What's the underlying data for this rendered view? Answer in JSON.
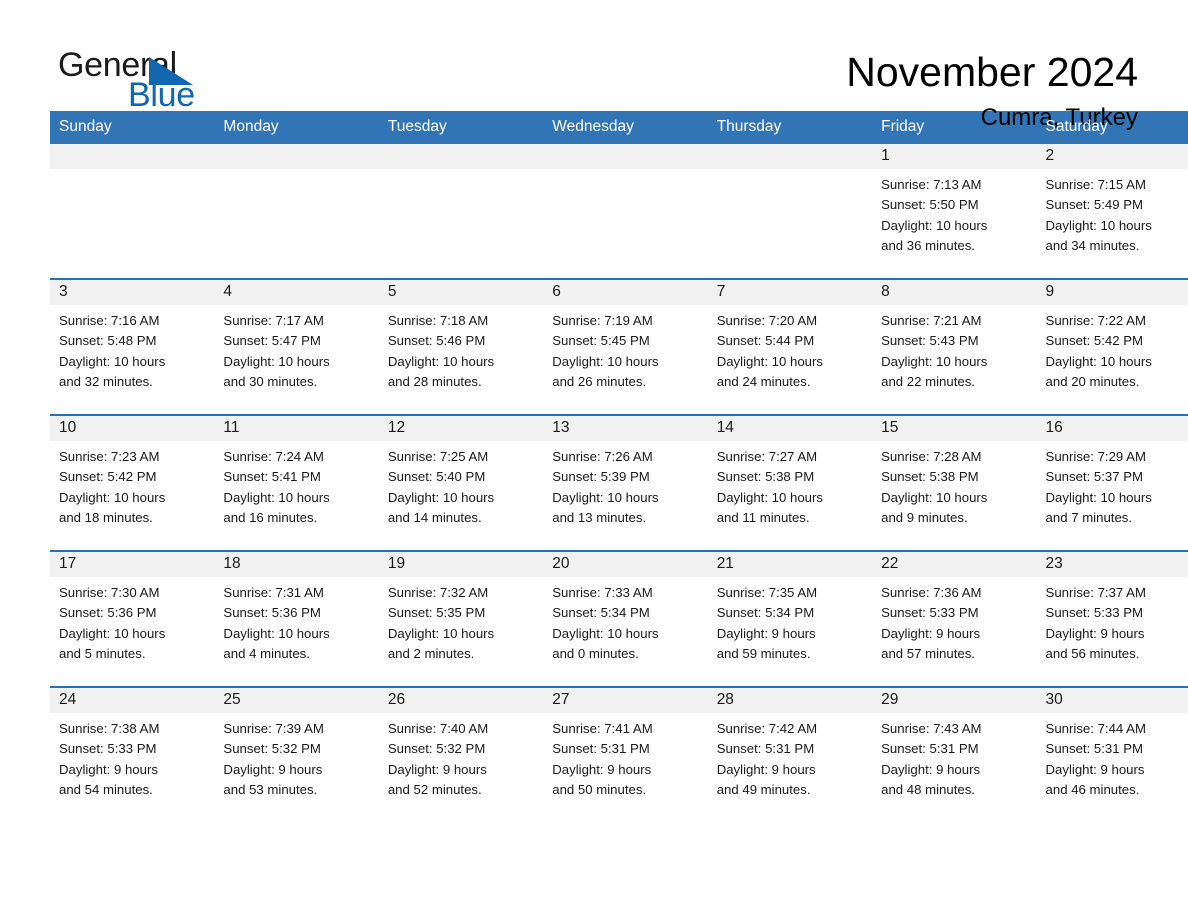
{
  "brand": {
    "name_part1": "General",
    "name_part2": "Blue",
    "flag_icon": "blue-triangle-flag-icon",
    "accent_color": "#1267b0"
  },
  "header": {
    "month_title": "November 2024",
    "location": "Cumra, Turkey"
  },
  "colors": {
    "header_blue": "#3275b7",
    "row_divider_blue": "#2c6fb1",
    "daynum_band": "#f1f1f1",
    "text": "#1a1a1a"
  },
  "calendar": {
    "weekday_headers": [
      "Sunday",
      "Monday",
      "Tuesday",
      "Wednesday",
      "Thursday",
      "Friday",
      "Saturday"
    ],
    "weeks": [
      [
        {
          "day": "",
          "lines": []
        },
        {
          "day": "",
          "lines": []
        },
        {
          "day": "",
          "lines": []
        },
        {
          "day": "",
          "lines": []
        },
        {
          "day": "",
          "lines": []
        },
        {
          "day": "1",
          "lines": [
            "Sunrise: 7:13 AM",
            "Sunset: 5:50 PM",
            "Daylight: 10 hours",
            "and 36 minutes."
          ]
        },
        {
          "day": "2",
          "lines": [
            "Sunrise: 7:15 AM",
            "Sunset: 5:49 PM",
            "Daylight: 10 hours",
            "and 34 minutes."
          ]
        }
      ],
      [
        {
          "day": "3",
          "lines": [
            "Sunrise: 7:16 AM",
            "Sunset: 5:48 PM",
            "Daylight: 10 hours",
            "and 32 minutes."
          ]
        },
        {
          "day": "4",
          "lines": [
            "Sunrise: 7:17 AM",
            "Sunset: 5:47 PM",
            "Daylight: 10 hours",
            "and 30 minutes."
          ]
        },
        {
          "day": "5",
          "lines": [
            "Sunrise: 7:18 AM",
            "Sunset: 5:46 PM",
            "Daylight: 10 hours",
            "and 28 minutes."
          ]
        },
        {
          "day": "6",
          "lines": [
            "Sunrise: 7:19 AM",
            "Sunset: 5:45 PM",
            "Daylight: 10 hours",
            "and 26 minutes."
          ]
        },
        {
          "day": "7",
          "lines": [
            "Sunrise: 7:20 AM",
            "Sunset: 5:44 PM",
            "Daylight: 10 hours",
            "and 24 minutes."
          ]
        },
        {
          "day": "8",
          "lines": [
            "Sunrise: 7:21 AM",
            "Sunset: 5:43 PM",
            "Daylight: 10 hours",
            "and 22 minutes."
          ]
        },
        {
          "day": "9",
          "lines": [
            "Sunrise: 7:22 AM",
            "Sunset: 5:42 PM",
            "Daylight: 10 hours",
            "and 20 minutes."
          ]
        }
      ],
      [
        {
          "day": "10",
          "lines": [
            "Sunrise: 7:23 AM",
            "Sunset: 5:42 PM",
            "Daylight: 10 hours",
            "and 18 minutes."
          ]
        },
        {
          "day": "11",
          "lines": [
            "Sunrise: 7:24 AM",
            "Sunset: 5:41 PM",
            "Daylight: 10 hours",
            "and 16 minutes."
          ]
        },
        {
          "day": "12",
          "lines": [
            "Sunrise: 7:25 AM",
            "Sunset: 5:40 PM",
            "Daylight: 10 hours",
            "and 14 minutes."
          ]
        },
        {
          "day": "13",
          "lines": [
            "Sunrise: 7:26 AM",
            "Sunset: 5:39 PM",
            "Daylight: 10 hours",
            "and 13 minutes."
          ]
        },
        {
          "day": "14",
          "lines": [
            "Sunrise: 7:27 AM",
            "Sunset: 5:38 PM",
            "Daylight: 10 hours",
            "and 11 minutes."
          ]
        },
        {
          "day": "15",
          "lines": [
            "Sunrise: 7:28 AM",
            "Sunset: 5:38 PM",
            "Daylight: 10 hours",
            "and 9 minutes."
          ]
        },
        {
          "day": "16",
          "lines": [
            "Sunrise: 7:29 AM",
            "Sunset: 5:37 PM",
            "Daylight: 10 hours",
            "and 7 minutes."
          ]
        }
      ],
      [
        {
          "day": "17",
          "lines": [
            "Sunrise: 7:30 AM",
            "Sunset: 5:36 PM",
            "Daylight: 10 hours",
            "and 5 minutes."
          ]
        },
        {
          "day": "18",
          "lines": [
            "Sunrise: 7:31 AM",
            "Sunset: 5:36 PM",
            "Daylight: 10 hours",
            "and 4 minutes."
          ]
        },
        {
          "day": "19",
          "lines": [
            "Sunrise: 7:32 AM",
            "Sunset: 5:35 PM",
            "Daylight: 10 hours",
            "and 2 minutes."
          ]
        },
        {
          "day": "20",
          "lines": [
            "Sunrise: 7:33 AM",
            "Sunset: 5:34 PM",
            "Daylight: 10 hours",
            "and 0 minutes."
          ]
        },
        {
          "day": "21",
          "lines": [
            "Sunrise: 7:35 AM",
            "Sunset: 5:34 PM",
            "Daylight: 9 hours",
            "and 59 minutes."
          ]
        },
        {
          "day": "22",
          "lines": [
            "Sunrise: 7:36 AM",
            "Sunset: 5:33 PM",
            "Daylight: 9 hours",
            "and 57 minutes."
          ]
        },
        {
          "day": "23",
          "lines": [
            "Sunrise: 7:37 AM",
            "Sunset: 5:33 PM",
            "Daylight: 9 hours",
            "and 56 minutes."
          ]
        }
      ],
      [
        {
          "day": "24",
          "lines": [
            "Sunrise: 7:38 AM",
            "Sunset: 5:33 PM",
            "Daylight: 9 hours",
            "and 54 minutes."
          ]
        },
        {
          "day": "25",
          "lines": [
            "Sunrise: 7:39 AM",
            "Sunset: 5:32 PM",
            "Daylight: 9 hours",
            "and 53 minutes."
          ]
        },
        {
          "day": "26",
          "lines": [
            "Sunrise: 7:40 AM",
            "Sunset: 5:32 PM",
            "Daylight: 9 hours",
            "and 52 minutes."
          ]
        },
        {
          "day": "27",
          "lines": [
            "Sunrise: 7:41 AM",
            "Sunset: 5:31 PM",
            "Daylight: 9 hours",
            "and 50 minutes."
          ]
        },
        {
          "day": "28",
          "lines": [
            "Sunrise: 7:42 AM",
            "Sunset: 5:31 PM",
            "Daylight: 9 hours",
            "and 49 minutes."
          ]
        },
        {
          "day": "29",
          "lines": [
            "Sunrise: 7:43 AM",
            "Sunset: 5:31 PM",
            "Daylight: 9 hours",
            "and 48 minutes."
          ]
        },
        {
          "day": "30",
          "lines": [
            "Sunrise: 7:44 AM",
            "Sunset: 5:31 PM",
            "Daylight: 9 hours",
            "and 46 minutes."
          ]
        }
      ]
    ]
  }
}
